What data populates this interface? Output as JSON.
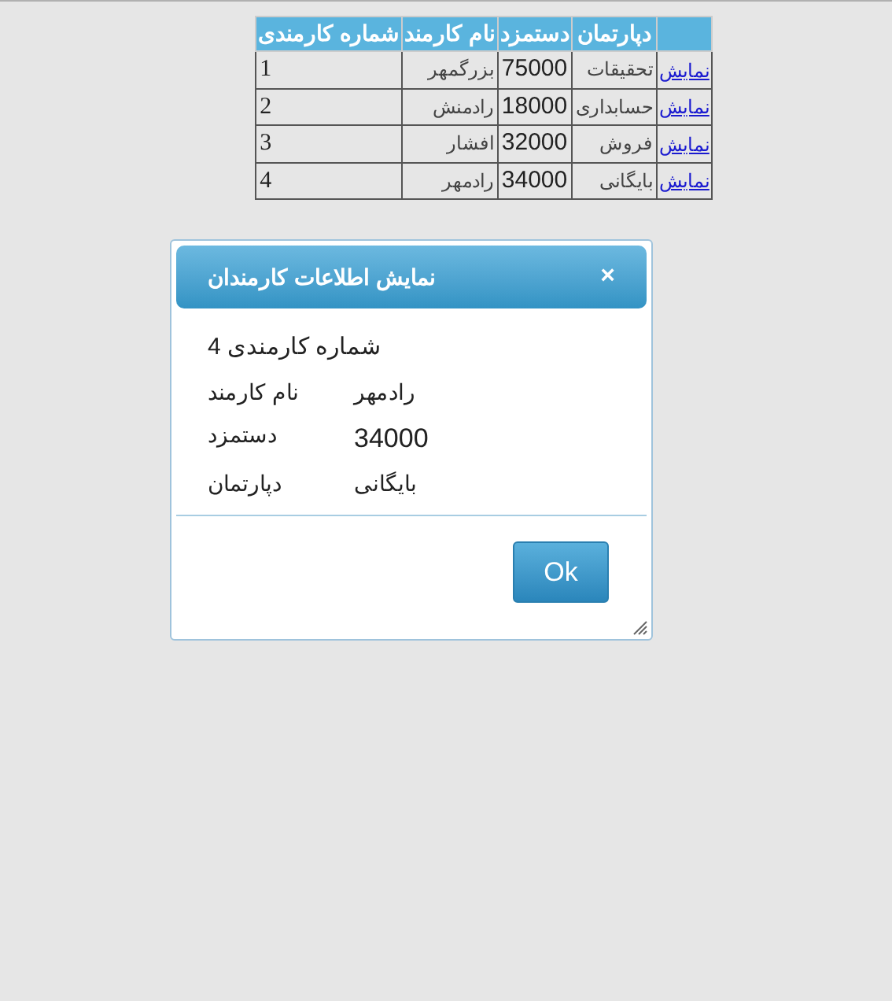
{
  "table": {
    "columns": [
      "دپارتمان",
      "دستمزد",
      "نام کارمند",
      "شماره کارمندی"
    ],
    "rows": [
      {
        "link": "نمایش",
        "cells": [
          "تحقیقات",
          "75000",
          "بزرگمهر",
          "1"
        ]
      },
      {
        "link": "نمایش",
        "cells": [
          "حسابداری",
          "18000",
          "رادمنش",
          "2"
        ]
      },
      {
        "link": "نمایش",
        "cells": [
          "فروش",
          "32000",
          "افشار",
          "3"
        ]
      },
      {
        "link": "نمایش",
        "cells": [
          "بایگانی",
          "34000",
          "رادمهر",
          "4"
        ]
      }
    ]
  },
  "dialog": {
    "title": "نمایش اطلاعات کارمندان",
    "close": "×",
    "first_line": "شماره کارمندی 4",
    "fields": [
      {
        "label": "نام کارمند",
        "value": "رادمهر"
      },
      {
        "label": "دستمزد",
        "value": "34000"
      },
      {
        "label": "دپارتمان",
        "value": "بایگانی"
      }
    ],
    "button": "Ok"
  }
}
